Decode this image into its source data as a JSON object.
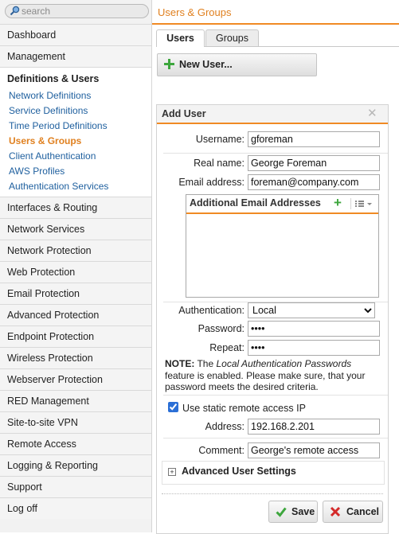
{
  "search": {
    "placeholder": "search"
  },
  "nav": {
    "items_top": [
      "Dashboard",
      "Management"
    ],
    "group": {
      "title": "Definitions & Users",
      "items": [
        "Network Definitions",
        "Service Definitions",
        "Time Period Definitions",
        "Users & Groups",
        "Client Authentication",
        "AWS Profiles",
        "Authentication Services"
      ],
      "active_index": 3
    },
    "items_bottom": [
      "Interfaces & Routing",
      "Network Services",
      "Network Protection",
      "Web Protection",
      "Email Protection",
      "Advanced Protection",
      "Endpoint Protection",
      "Wireless Protection",
      "Webserver Protection",
      "RED Management",
      "Site-to-site VPN",
      "Remote Access",
      "Logging & Reporting",
      "Support",
      "Log off"
    ]
  },
  "header": {
    "title": "Users & Groups"
  },
  "tabs": [
    {
      "label": "Users"
    },
    {
      "label": "Groups"
    }
  ],
  "toolbar": {
    "new_user_label": "New User..."
  },
  "form": {
    "title": "Add User",
    "username": {
      "label": "Username:",
      "value": "gforeman"
    },
    "real_name": {
      "label": "Real name:",
      "value": "George Foreman"
    },
    "email": {
      "label": "Email address:",
      "value": "foreman@company.com"
    },
    "additional_emails": {
      "title": "Additional Email Addresses"
    },
    "authentication": {
      "label": "Authentication:",
      "value": "Local"
    },
    "password": {
      "label": "Password:",
      "value": "••••"
    },
    "repeat": {
      "label": "Repeat:",
      "value": "••••"
    },
    "note": {
      "prefix": "NOTE:",
      "text_1": " The ",
      "emphasis": "Local Authentication Passwords",
      "text_2": " feature is enabled. Please make sure, that your password meets the desired criteria."
    },
    "static_ip": {
      "label": "Use static remote access IP",
      "checked": true
    },
    "address": {
      "label": "Address:",
      "value": "192.168.2.201"
    },
    "comment": {
      "label": "Comment:",
      "value": "George's remote access"
    },
    "advanced": {
      "label": "Advanced User Settings"
    },
    "save_label": "Save",
    "cancel_label": "Cancel"
  },
  "colors": {
    "accent": "#f08a24",
    "link": "#1e5f9e",
    "active": "#e0801f",
    "save_green": "#3da63d",
    "cancel_red": "#d42a2a"
  }
}
